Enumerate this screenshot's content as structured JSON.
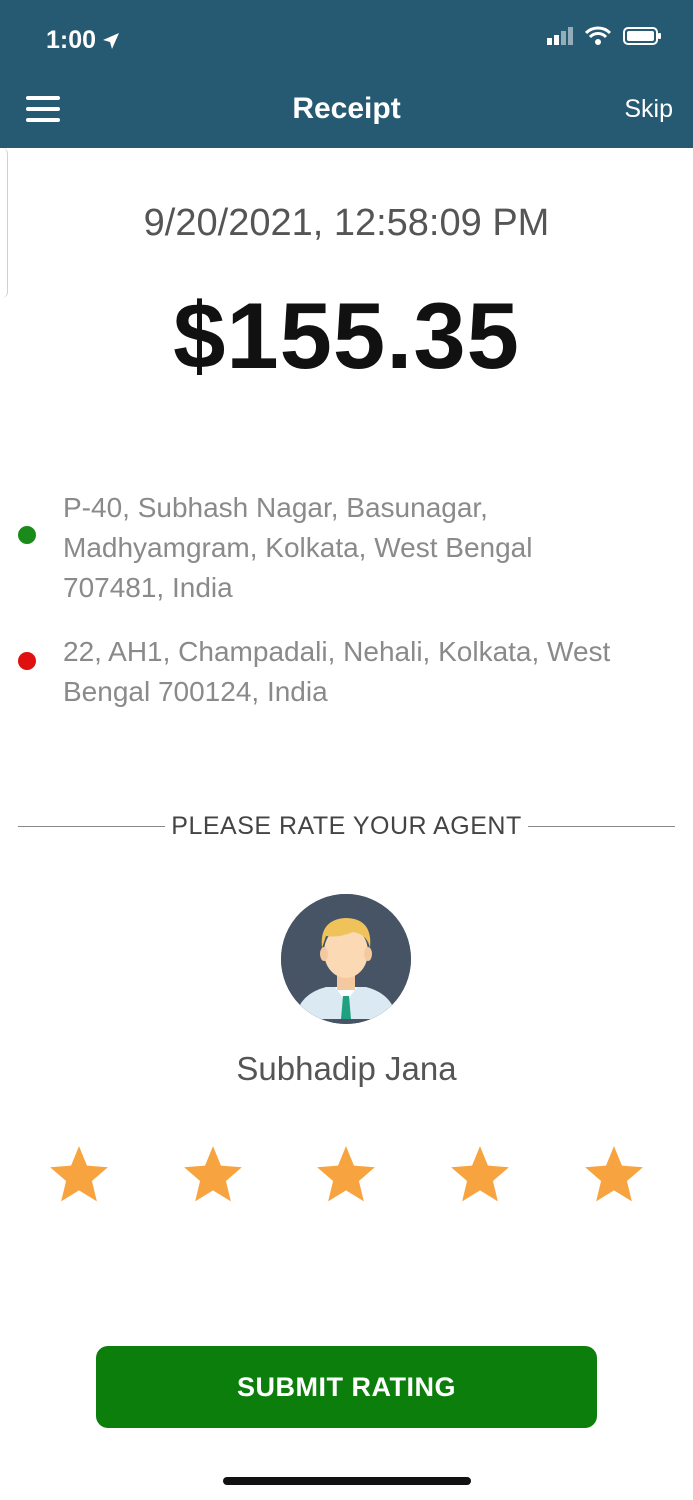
{
  "status_bar": {
    "time": "1:00",
    "icons": [
      "location-arrow-icon",
      "signal-icon",
      "wifi-icon",
      "battery-icon"
    ]
  },
  "nav": {
    "title": "Receipt",
    "skip_label": "Skip",
    "background_color": "#265a72"
  },
  "receipt": {
    "datetime": "9/20/2021, 12:58:09 PM",
    "amount": "$155.35"
  },
  "addresses": {
    "pickup": {
      "line1": "P-40, Subhash Nagar, Basunagar,",
      "line2": "Madhyamgram, Kolkata, West Bengal",
      "line3": "707481, India",
      "dot_color": "#1a8a1a"
    },
    "dropoff": {
      "line1": "22, AH1, Champadali, Nehali, Kolkata, West",
      "line2": "Bengal 700124, India",
      "dot_color": "#e01010"
    }
  },
  "rating": {
    "heading": "PLEASE RATE YOUR AGENT",
    "agent_name": "Subhadip Jana",
    "stars_total": 5,
    "stars_selected": 5,
    "star_color": "#f7a440"
  },
  "actions": {
    "submit_label": "SUBMIT RATING",
    "submit_color": "#0c7e0c"
  }
}
